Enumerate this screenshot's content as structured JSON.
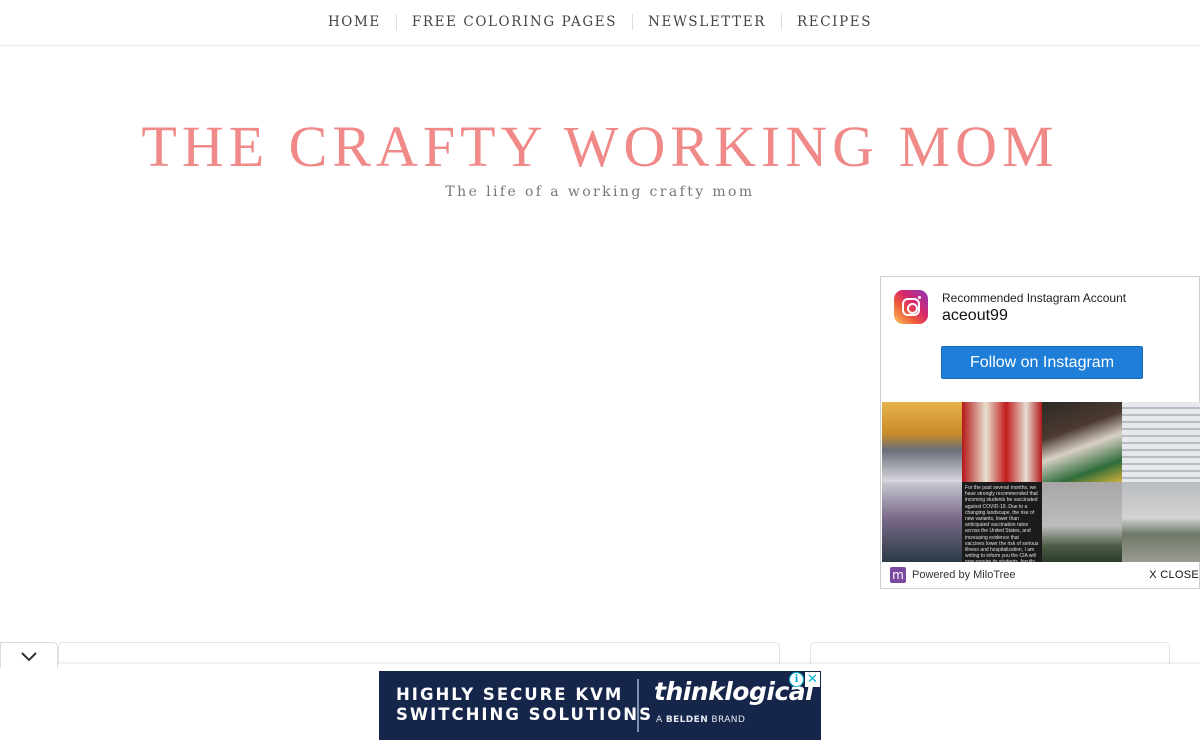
{
  "nav": {
    "items": [
      {
        "label": "HOME"
      },
      {
        "label": "FREE COLORING PAGES"
      },
      {
        "label": "NEWSLETTER"
      },
      {
        "label": "RECIPES"
      }
    ]
  },
  "header": {
    "title": "THE CRAFTY WORKING MOM",
    "tagline": "The life of a working crafty mom"
  },
  "instagram_widget": {
    "heading": "Recommended Instagram Account",
    "account": "aceout99",
    "follow_label": "Follow on Instagram",
    "post_text": "For the past several months, we have strongly recommended that incoming students be vaccinated against COVID-19. Due to a changing landscape, the rise of new variants, lower than anticipated vaccination rates across the United States, and increasing evidence that vaccines lower the risk of serious illness and hospitalization, I am writing to inform you the CIA will now require its students, faculty, and staff to become vaccinated against COVID-19.",
    "powered_by": "Powered by MiloTree",
    "close_label": "X CLOSE"
  },
  "ad": {
    "line1": "HIGHLY SECURE KVM",
    "line2": "SWITCHING SOLUTIONS",
    "brand": "thinklogical",
    "sub_prefix": "A",
    "sub_brand": "BELDEN",
    "sub_suffix": "BRAND",
    "info_glyph": "i",
    "close_glyph": "✕"
  },
  "colors": {
    "title": "#f08a88",
    "follow_button": "#1f7fd8",
    "ad_background": "#15264a",
    "ad_icons": "#00aecd"
  }
}
